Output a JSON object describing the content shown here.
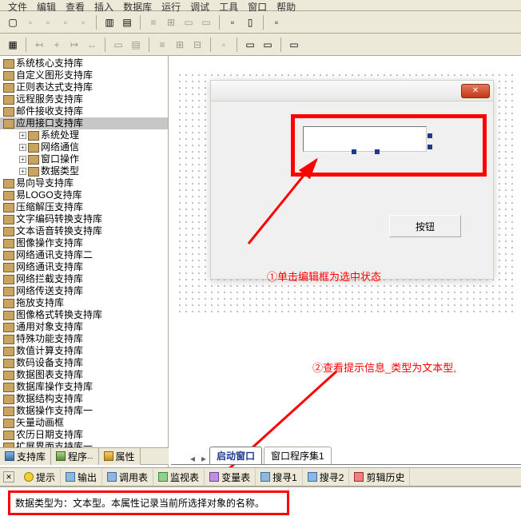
{
  "menu": [
    "文件",
    "编辑",
    "查看",
    "插入",
    "数据库",
    "运行",
    "调试",
    "工具",
    "窗口",
    "帮助"
  ],
  "tree": {
    "items": [
      {
        "l": "系统核心支持库",
        "c": 0
      },
      {
        "l": "自定义图形支持库",
        "c": 0
      },
      {
        "l": "正则表达式支持库",
        "c": 0
      },
      {
        "l": "远程服务支持库",
        "c": 0
      },
      {
        "l": "邮件接收支持库",
        "c": 0
      },
      {
        "l": "应用接口支持库",
        "c": 0,
        "sel": true
      },
      {
        "l": "系统处理",
        "c": 1,
        "exp": "+"
      },
      {
        "l": "网络通信",
        "c": 1,
        "exp": "+"
      },
      {
        "l": "窗口操作",
        "c": 1,
        "exp": "+"
      },
      {
        "l": "数据类型",
        "c": 1,
        "exp": "+"
      },
      {
        "l": "易向导支持库",
        "c": 0
      },
      {
        "l": "易LOGO支持库",
        "c": 0
      },
      {
        "l": "压缩解压支持库",
        "c": 0
      },
      {
        "l": "文字编码转换支持库",
        "c": 0
      },
      {
        "l": "文本语音转换支持库",
        "c": 0
      },
      {
        "l": "图像操作支持库",
        "c": 0
      },
      {
        "l": "网络通讯支持库二",
        "c": 0
      },
      {
        "l": "网络通讯支持库",
        "c": 0
      },
      {
        "l": "网络拦截支持库",
        "c": 0
      },
      {
        "l": "网络传送支持库",
        "c": 0
      },
      {
        "l": "拖放支持库",
        "c": 0
      },
      {
        "l": "图像格式转换支持库",
        "c": 0
      },
      {
        "l": "通用对象支持库",
        "c": 0
      },
      {
        "l": "特殊功能支持库",
        "c": 0
      },
      {
        "l": "数值计算支持库",
        "c": 0
      },
      {
        "l": "数码设备支持库",
        "c": 0
      },
      {
        "l": "数据图表支持库",
        "c": 0
      },
      {
        "l": "数据库操作支持库",
        "c": 0
      },
      {
        "l": "数据结构支持库",
        "c": 0
      },
      {
        "l": "数据操作支持库一",
        "c": 0
      },
      {
        "l": "矢量动画框",
        "c": 0
      },
      {
        "l": "农历日期支持库",
        "c": 0
      },
      {
        "l": "扩展界面支持库一",
        "c": 0
      }
    ]
  },
  "left_tabs": [
    "支持库",
    "程序",
    "属性"
  ],
  "right_tabs": {
    "t1": "启动窗口",
    "t2": "窗口程序集1"
  },
  "output_tabs": {
    "hint": "提示",
    "out": "输出",
    "call": "调用表",
    "watch": "监视表",
    "var": "变量表",
    "s1": "搜寻1",
    "s2": "搜寻2",
    "clip": "剪辑历史"
  },
  "form_button": "按钮",
  "annotation1": "①单击编辑框为选中状态",
  "annotation2": "②查看提示信息_类型为文本型,",
  "status_text": "数据类型为：文本型。本属性记录当前所选择对象的名称。"
}
